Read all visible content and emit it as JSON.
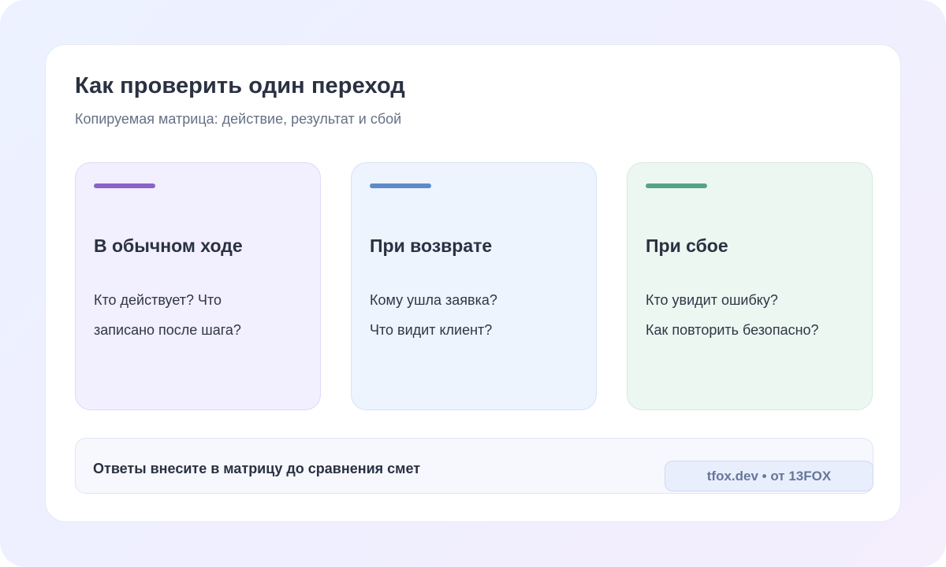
{
  "header": {
    "title": "Как проверить один переход",
    "subtitle": "Копируемая матрица: действие, результат и сбой"
  },
  "columns": [
    {
      "title": "В обычном ходе",
      "lines": [
        "Кто действует? Что",
        "записано после шага?"
      ],
      "accent_color": "#8a63c9",
      "background_color": "#f2effe"
    },
    {
      "title": "При возврате",
      "lines": [
        "Кому ушла заявка?",
        "Что видит клиент?"
      ],
      "accent_color": "#5b8bca",
      "background_color": "#edf4fe"
    },
    {
      "title": "При сбое",
      "lines": [
        "Кто увидит ошибку?",
        "Как повторить безопасно?"
      ],
      "accent_color": "#54a587",
      "background_color": "#edf7f1"
    }
  ],
  "footer": {
    "note": "Ответы внесите в матрицу до сравнения смет",
    "badge": "tfox.dev • от 13FOX"
  }
}
